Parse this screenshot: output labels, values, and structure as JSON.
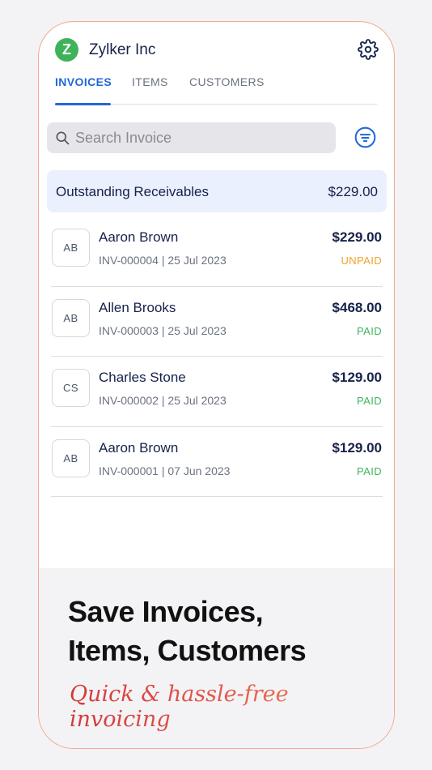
{
  "app": {
    "logo_letter": "Z",
    "company_name": "Zylker Inc"
  },
  "tabs": [
    {
      "label": "INVOICES",
      "active": true
    },
    {
      "label": "ITEMS",
      "active": false
    },
    {
      "label": "CUSTOMERS",
      "active": false
    }
  ],
  "search": {
    "placeholder": "Search Invoice"
  },
  "receivables": {
    "label": "Outstanding Receivables",
    "amount": "$229.00"
  },
  "invoices": [
    {
      "initials": "AB",
      "name": "Aaron Brown",
      "meta": "INV-000004 | 25 Jul 2023",
      "amount": "$229.00",
      "status": "UNPAID"
    },
    {
      "initials": "AB",
      "name": "Allen Brooks",
      "meta": "INV-000003 | 25 Jul 2023",
      "amount": "$468.00",
      "status": "PAID"
    },
    {
      "initials": "CS",
      "name": "Charles Stone",
      "meta": "INV-000002 | 25 Jul 2023",
      "amount": "$129.00",
      "status": "PAID"
    },
    {
      "initials": "AB",
      "name": "Aaron Brown",
      "meta": "INV-000001 | 07 Jun 2023",
      "amount": "$129.00",
      "status": "PAID"
    }
  ],
  "promo": {
    "title_line1": "Save Invoices,",
    "title_line2": "Items, Customers",
    "tagline": "Quick & hassle-free invoicing"
  },
  "colors": {
    "accent": "#2368d8",
    "logo": "#3fb25a",
    "paid": "#3cb55e",
    "unpaid": "#eea32a",
    "frame": "#f1a88e"
  },
  "icons": {
    "settings": "gear-icon",
    "search": "search-icon",
    "filter": "filter-icon"
  }
}
